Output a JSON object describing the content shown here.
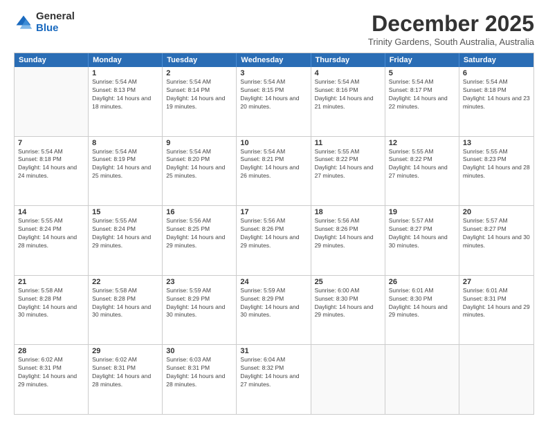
{
  "logo": {
    "general": "General",
    "blue": "Blue"
  },
  "header": {
    "title": "December 2025",
    "subtitle": "Trinity Gardens, South Australia, Australia"
  },
  "days_of_week": [
    "Sunday",
    "Monday",
    "Tuesday",
    "Wednesday",
    "Thursday",
    "Friday",
    "Saturday"
  ],
  "weeks": [
    [
      {
        "day": "",
        "sunrise": "",
        "sunset": "",
        "daylight": ""
      },
      {
        "day": "1",
        "sunrise": "Sunrise: 5:54 AM",
        "sunset": "Sunset: 8:13 PM",
        "daylight": "Daylight: 14 hours and 18 minutes."
      },
      {
        "day": "2",
        "sunrise": "Sunrise: 5:54 AM",
        "sunset": "Sunset: 8:14 PM",
        "daylight": "Daylight: 14 hours and 19 minutes."
      },
      {
        "day": "3",
        "sunrise": "Sunrise: 5:54 AM",
        "sunset": "Sunset: 8:15 PM",
        "daylight": "Daylight: 14 hours and 20 minutes."
      },
      {
        "day": "4",
        "sunrise": "Sunrise: 5:54 AM",
        "sunset": "Sunset: 8:16 PM",
        "daylight": "Daylight: 14 hours and 21 minutes."
      },
      {
        "day": "5",
        "sunrise": "Sunrise: 5:54 AM",
        "sunset": "Sunset: 8:17 PM",
        "daylight": "Daylight: 14 hours and 22 minutes."
      },
      {
        "day": "6",
        "sunrise": "Sunrise: 5:54 AM",
        "sunset": "Sunset: 8:18 PM",
        "daylight": "Daylight: 14 hours and 23 minutes."
      }
    ],
    [
      {
        "day": "7",
        "sunrise": "Sunrise: 5:54 AM",
        "sunset": "Sunset: 8:18 PM",
        "daylight": "Daylight: 14 hours and 24 minutes."
      },
      {
        "day": "8",
        "sunrise": "Sunrise: 5:54 AM",
        "sunset": "Sunset: 8:19 PM",
        "daylight": "Daylight: 14 hours and 25 minutes."
      },
      {
        "day": "9",
        "sunrise": "Sunrise: 5:54 AM",
        "sunset": "Sunset: 8:20 PM",
        "daylight": "Daylight: 14 hours and 25 minutes."
      },
      {
        "day": "10",
        "sunrise": "Sunrise: 5:54 AM",
        "sunset": "Sunset: 8:21 PM",
        "daylight": "Daylight: 14 hours and 26 minutes."
      },
      {
        "day": "11",
        "sunrise": "Sunrise: 5:55 AM",
        "sunset": "Sunset: 8:22 PM",
        "daylight": "Daylight: 14 hours and 27 minutes."
      },
      {
        "day": "12",
        "sunrise": "Sunrise: 5:55 AM",
        "sunset": "Sunset: 8:22 PM",
        "daylight": "Daylight: 14 hours and 27 minutes."
      },
      {
        "day": "13",
        "sunrise": "Sunrise: 5:55 AM",
        "sunset": "Sunset: 8:23 PM",
        "daylight": "Daylight: 14 hours and 28 minutes."
      }
    ],
    [
      {
        "day": "14",
        "sunrise": "Sunrise: 5:55 AM",
        "sunset": "Sunset: 8:24 PM",
        "daylight": "Daylight: 14 hours and 28 minutes."
      },
      {
        "day": "15",
        "sunrise": "Sunrise: 5:55 AM",
        "sunset": "Sunset: 8:24 PM",
        "daylight": "Daylight: 14 hours and 29 minutes."
      },
      {
        "day": "16",
        "sunrise": "Sunrise: 5:56 AM",
        "sunset": "Sunset: 8:25 PM",
        "daylight": "Daylight: 14 hours and 29 minutes."
      },
      {
        "day": "17",
        "sunrise": "Sunrise: 5:56 AM",
        "sunset": "Sunset: 8:26 PM",
        "daylight": "Daylight: 14 hours and 29 minutes."
      },
      {
        "day": "18",
        "sunrise": "Sunrise: 5:56 AM",
        "sunset": "Sunset: 8:26 PM",
        "daylight": "Daylight: 14 hours and 29 minutes."
      },
      {
        "day": "19",
        "sunrise": "Sunrise: 5:57 AM",
        "sunset": "Sunset: 8:27 PM",
        "daylight": "Daylight: 14 hours and 30 minutes."
      },
      {
        "day": "20",
        "sunrise": "Sunrise: 5:57 AM",
        "sunset": "Sunset: 8:27 PM",
        "daylight": "Daylight: 14 hours and 30 minutes."
      }
    ],
    [
      {
        "day": "21",
        "sunrise": "Sunrise: 5:58 AM",
        "sunset": "Sunset: 8:28 PM",
        "daylight": "Daylight: 14 hours and 30 minutes."
      },
      {
        "day": "22",
        "sunrise": "Sunrise: 5:58 AM",
        "sunset": "Sunset: 8:28 PM",
        "daylight": "Daylight: 14 hours and 30 minutes."
      },
      {
        "day": "23",
        "sunrise": "Sunrise: 5:59 AM",
        "sunset": "Sunset: 8:29 PM",
        "daylight": "Daylight: 14 hours and 30 minutes."
      },
      {
        "day": "24",
        "sunrise": "Sunrise: 5:59 AM",
        "sunset": "Sunset: 8:29 PM",
        "daylight": "Daylight: 14 hours and 30 minutes."
      },
      {
        "day": "25",
        "sunrise": "Sunrise: 6:00 AM",
        "sunset": "Sunset: 8:30 PM",
        "daylight": "Daylight: 14 hours and 29 minutes."
      },
      {
        "day": "26",
        "sunrise": "Sunrise: 6:01 AM",
        "sunset": "Sunset: 8:30 PM",
        "daylight": "Daylight: 14 hours and 29 minutes."
      },
      {
        "day": "27",
        "sunrise": "Sunrise: 6:01 AM",
        "sunset": "Sunset: 8:31 PM",
        "daylight": "Daylight: 14 hours and 29 minutes."
      }
    ],
    [
      {
        "day": "28",
        "sunrise": "Sunrise: 6:02 AM",
        "sunset": "Sunset: 8:31 PM",
        "daylight": "Daylight: 14 hours and 29 minutes."
      },
      {
        "day": "29",
        "sunrise": "Sunrise: 6:02 AM",
        "sunset": "Sunset: 8:31 PM",
        "daylight": "Daylight: 14 hours and 28 minutes."
      },
      {
        "day": "30",
        "sunrise": "Sunrise: 6:03 AM",
        "sunset": "Sunset: 8:31 PM",
        "daylight": "Daylight: 14 hours and 28 minutes."
      },
      {
        "day": "31",
        "sunrise": "Sunrise: 6:04 AM",
        "sunset": "Sunset: 8:32 PM",
        "daylight": "Daylight: 14 hours and 27 minutes."
      },
      {
        "day": "",
        "sunrise": "",
        "sunset": "",
        "daylight": ""
      },
      {
        "day": "",
        "sunrise": "",
        "sunset": "",
        "daylight": ""
      },
      {
        "day": "",
        "sunrise": "",
        "sunset": "",
        "daylight": ""
      }
    ]
  ]
}
